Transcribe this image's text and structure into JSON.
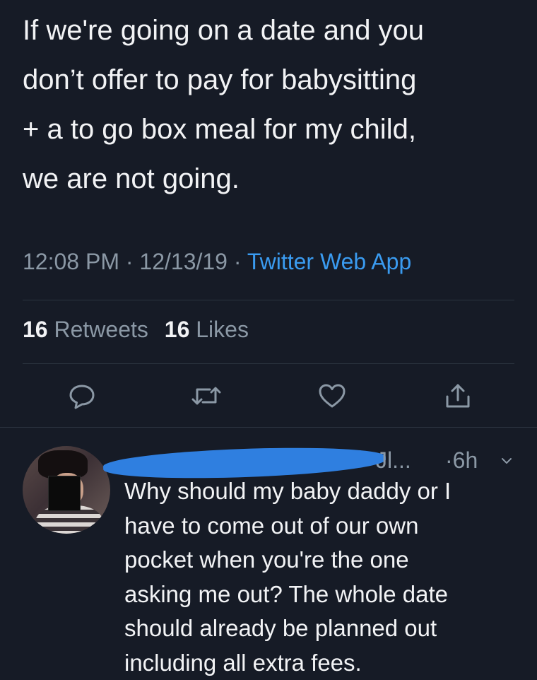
{
  "tweet": {
    "text": "If we're going on a date and you\ndon’t offer to pay for babysitting\n+ a to go box meal for my child,\nwe are not going.",
    "time": "12:08 PM",
    "date": "12/13/19",
    "source": "Twitter Web App",
    "retweets_count": "16",
    "retweets_label": "Retweets",
    "likes_count": "16",
    "likes_label": "Likes"
  },
  "actions": {
    "reply_icon": "reply-icon",
    "retweet_icon": "retweet-icon",
    "like_icon": "heart-icon",
    "share_icon": "share-icon"
  },
  "reply": {
    "handle_fragment": "Jl...",
    "time": "6h",
    "text": "Why should my baby daddy or I\nhave to come out of our own\npocket when you're the one\nasking me out? The whole date\nshould already be planned out\nincluding all extra fees."
  },
  "colors": {
    "background": "#161b26",
    "text": "#f2f3f5",
    "secondary": "#8b98a5",
    "link": "#3a9bf0",
    "redaction": "#2f7fe0"
  }
}
